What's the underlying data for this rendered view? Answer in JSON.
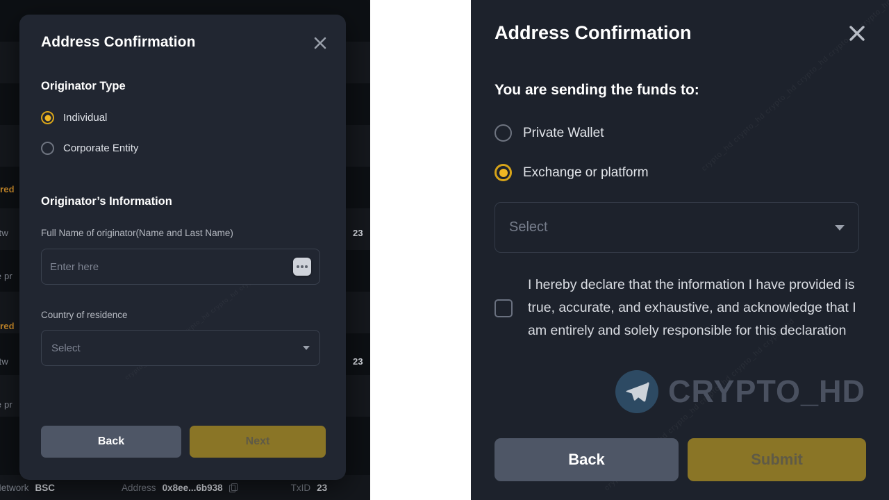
{
  "left_panel": {
    "modal": {
      "title": "Address Confirmation",
      "close_icon": "close-icon",
      "section_originator_type": "Originator Type",
      "originator_type_options": [
        {
          "label": "Individual",
          "selected": true
        },
        {
          "label": "Corporate Entity",
          "selected": false
        }
      ],
      "section_originator_info": "Originator’s Information",
      "full_name_label": "Full Name of originator(Name and Last Name)",
      "full_name_value": "",
      "full_name_placeholder": "Enter here",
      "full_name_suffix_icon": "more-dots-icon",
      "country_label": "Country of residence",
      "country_value": "",
      "country_placeholder": "Select",
      "country_caret_icon": "chevron-down-icon",
      "back_label": "Back",
      "next_label": "Next"
    },
    "background": {
      "status_text": "uired",
      "network_text": "letw",
      "purpose_text": "se pr",
      "amount_text": "23",
      "bottom_bar": {
        "network_label": "Network",
        "network_value": "BSC",
        "address_label": "Address",
        "address_value": "0x8ee...6b938",
        "copy_icon": "copy-icon",
        "txid_label": "TxID",
        "txid_value": "23"
      }
    }
  },
  "right_panel": {
    "title": "Address Confirmation",
    "close_icon": "close-icon",
    "heading": "You are sending the funds to:",
    "destination_options": [
      {
        "label": "Private Wallet",
        "selected": false
      },
      {
        "label": "Exchange or platform",
        "selected": true
      }
    ],
    "exchange_select_value": "",
    "exchange_select_placeholder": "Select",
    "exchange_caret_icon": "chevron-down-icon",
    "declaration_checked": false,
    "declaration_text": "I hereby declare that the information I have provided is true, accurate, and exhaustive, and acknowledge that I am entirely and solely responsible for this declaration",
    "watermark": {
      "logo_icon": "telegram-icon",
      "text": "CRYPTO_HD"
    },
    "back_label": "Back",
    "submit_label": "Submit"
  },
  "colors": {
    "accent_gold": "#f0b723",
    "button_gold": "#8a7526",
    "button_gray": "#4e5666",
    "modal_bg_left": "#212631",
    "modal_bg_right": "#1d222c",
    "page_bg": "#0d1014",
    "status_orange": "#c98a2a"
  }
}
